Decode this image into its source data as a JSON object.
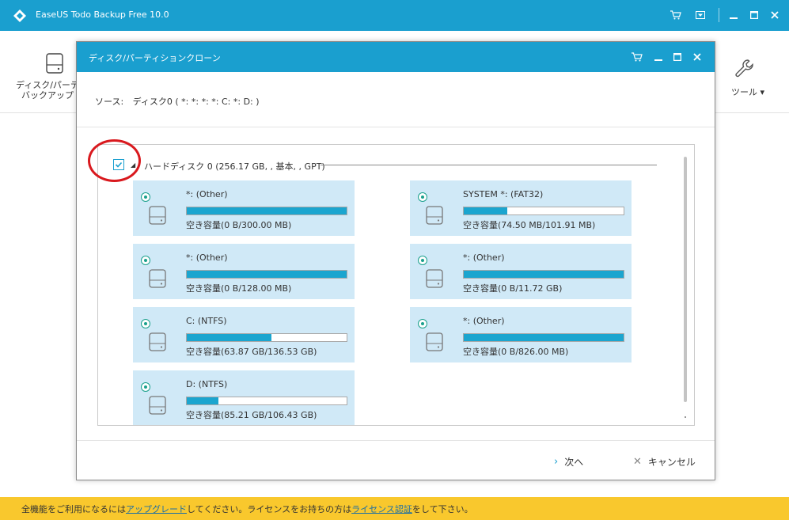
{
  "app": {
    "title": "EaseUS Todo Backup Free 10.0",
    "accent_color": "#1a9fcf",
    "title_icons": [
      "cart-icon",
      "menu-icon",
      "minimize-icon",
      "maximize-icon",
      "close-icon"
    ]
  },
  "toolbar": {
    "left_item_label_1": "ディスク/パーティ",
    "left_item_label_2": "バックアップ",
    "left_item_icon": "hard-drive-icon",
    "tools_label": "ツール ▾",
    "tools_icon": "wrench-icon"
  },
  "dialog": {
    "title": "ディスク/パーティションクローン",
    "source_label": "ソース:",
    "source_value": "ディスク0 ( *: *: *: *: C: *: D: )",
    "disk": {
      "label": "ハードディスク 0 (256.17 GB, , 基本, , GPT)",
      "checked": true
    },
    "partitions": [
      {
        "name": "*: (Other)",
        "capacity": "空き容量(0 B/300.00 MB)",
        "used_fraction": 1.0
      },
      {
        "name": "SYSTEM *: (FAT32)",
        "capacity": "空き容量(74.50 MB/101.91 MB)",
        "used_fraction": 0.27
      },
      {
        "name": "*: (Other)",
        "capacity": "空き容量(0 B/128.00 MB)",
        "used_fraction": 1.0
      },
      {
        "name": "*: (Other)",
        "capacity": "空き容量(0 B/11.72 GB)",
        "used_fraction": 1.0
      },
      {
        "name": "C: (NTFS)",
        "capacity": "空き容量(63.87 GB/136.53 GB)",
        "used_fraction": 0.53
      },
      {
        "name": "*: (Other)",
        "capacity": "空き容量(0 B/826.00 MB)",
        "used_fraction": 1.0
      },
      {
        "name": "D: (NTFS)",
        "capacity": "空き容量(85.21 GB/106.43 GB)",
        "used_fraction": 0.2
      }
    ],
    "next_label": "次へ",
    "cancel_label": "キャンセル"
  },
  "footer": {
    "text_1": "全機能をご利用になるには",
    "link_1": "アップグレード",
    "text_2": "してください。ライセンスをお持ちの方は",
    "link_2": "ライセンス認証",
    "text_3": "をして下さい。",
    "bg_color": "#f9c82d"
  }
}
